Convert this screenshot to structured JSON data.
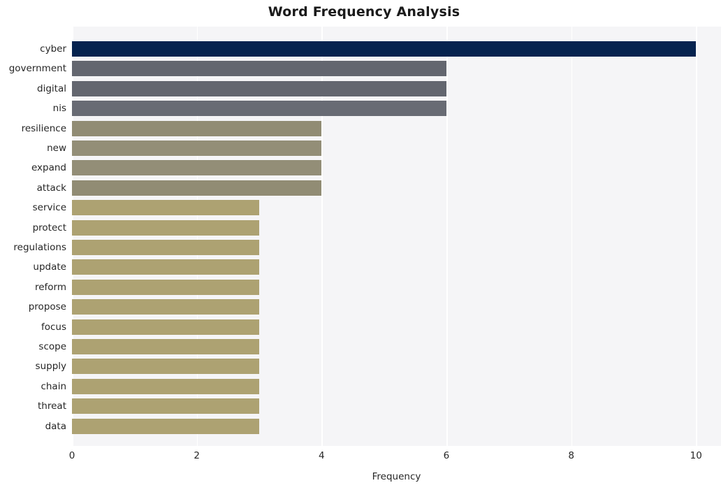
{
  "chart_data": {
    "type": "bar",
    "orientation": "horizontal",
    "title": "Word Frequency Analysis",
    "xlabel": "Frequency",
    "ylabel": "",
    "xlim": [
      0,
      10.4
    ],
    "ylim_categories": 20,
    "xticks": [
      0,
      2,
      4,
      6,
      8,
      10
    ],
    "xtick_labels": [
      "0",
      "2",
      "4",
      "6",
      "8",
      "10"
    ],
    "grid": "vertical-only",
    "legend": "none",
    "background": "#f5f5f7",
    "categories": [
      "cyber",
      "government",
      "digital",
      "nis",
      "resilience",
      "new",
      "expand",
      "attack",
      "service",
      "protect",
      "regulations",
      "update",
      "reform",
      "propose",
      "focus",
      "scope",
      "supply",
      "chain",
      "threat",
      "data"
    ],
    "values": [
      10,
      6,
      6,
      6,
      4,
      4,
      4,
      4,
      3,
      3,
      3,
      3,
      3,
      3,
      3,
      3,
      3,
      3,
      3,
      3
    ],
    "bar_colors": [
      "#06234f",
      "#63666f",
      "#63666f",
      "#686b74",
      "#918c74",
      "#938e77",
      "#938e77",
      "#918c74",
      "#ada272",
      "#ada272",
      "#ada272",
      "#ada272",
      "#ada272",
      "#ada272",
      "#ada272",
      "#ada272",
      "#ada272",
      "#ada272",
      "#ada272",
      "#ada272"
    ]
  },
  "colors": {
    "highest": "#06234f",
    "mid_grey": "#63666f",
    "olive": "#918c74",
    "khaki": "#ada272",
    "plot_background": "#f5f5f7",
    "gridline": "#ffffff",
    "text": "#262626",
    "title_text": "#1a1a1a"
  }
}
